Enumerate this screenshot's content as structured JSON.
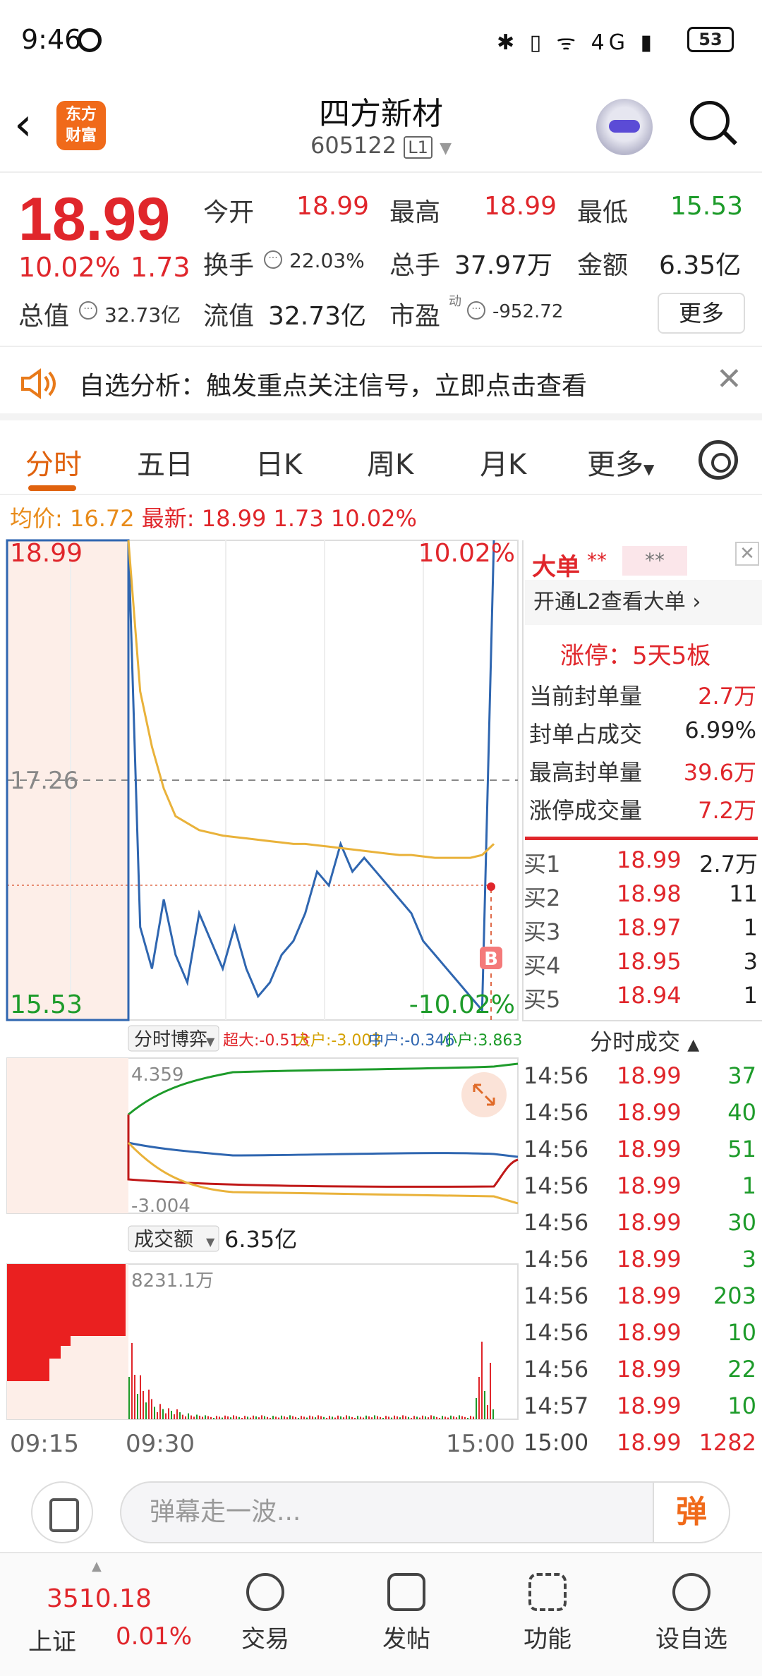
{
  "status_bar": {
    "time": "9:46",
    "signal": "4G",
    "battery": "53"
  },
  "header": {
    "logo_line1": "东方",
    "logo_line2": "财富",
    "stock_name": "四方新材",
    "stock_code": "605122",
    "level_badge": "L1"
  },
  "quote": {
    "price": "18.99",
    "change_pct": "10.02%",
    "change": "1.73",
    "open_label": "今开",
    "open": "18.99",
    "high_label": "最高",
    "high": "18.99",
    "low_label": "最低",
    "low": "15.53",
    "turnover_label": "换手",
    "turnover": "22.03%",
    "volume_label": "总手",
    "volume": "37.97万",
    "amount_label": "金额",
    "amount": "6.35亿",
    "mktcap_label": "总值",
    "mktcap": "32.73亿",
    "float_label": "流值",
    "float_cap": "32.73亿",
    "pe_label": "市盈",
    "pe_sup": "动",
    "pe": "-952.72",
    "more_label": "更多"
  },
  "alert": {
    "text": "自选分析：触发重点关注信号，立即点击查看"
  },
  "tabs": [
    "分时",
    "五日",
    "日K",
    "周K",
    "月K",
    "更多"
  ],
  "infoline": {
    "avg_label": "均价:",
    "avg": "16.72",
    "latest_label": "最新:",
    "latest": "18.99",
    "chg": "1.73",
    "pct": "10.02%"
  },
  "chart_labels": {
    "top_price": "18.99",
    "top_pct": "10.02%",
    "mid_price": "17.26",
    "bottom_price": "15.53",
    "bottom_pct": "-10.02%",
    "b_marker": "B",
    "fund_title": "分时博弈",
    "fund_super": "超大:-0.513",
    "fund_big": "大户:-3.003",
    "fund_mid": "中户:-0.346",
    "fund_small": "小户:3.863",
    "fund_max": "4.359",
    "fund_min": "-3.004",
    "amount_title": "成交额",
    "amount_total": "6.35亿",
    "amount_max": "8231.1万",
    "t_start": "09:15",
    "t_open": "09:30",
    "t_end": "15:00"
  },
  "chart_data": {
    "type": "line",
    "title": "",
    "y_range": [
      15.53,
      18.99
    ],
    "x_range": [
      "09:30",
      "15:00"
    ],
    "series": [
      {
        "name": "",
        "color": "#2f66b0",
        "values": [
          18.99,
          16.2,
          15.9,
          16.4,
          16.0,
          15.8,
          16.3,
          16.1,
          15.9,
          16.2,
          15.9,
          15.7,
          15.8,
          16.0,
          16.1,
          16.3,
          16.6,
          16.5,
          16.8,
          16.6,
          16.7,
          16.6,
          16.5,
          16.4,
          16.3,
          16.1,
          16.0,
          15.9,
          15.8,
          15.7,
          15.6,
          18.99
        ]
      },
      {
        "name": "均价",
        "color": "#e9b23a",
        "values": [
          18.99,
          17.9,
          17.5,
          17.2,
          17.0,
          16.95,
          16.9,
          16.88,
          16.86,
          16.85,
          16.84,
          16.83,
          16.82,
          16.81,
          16.8,
          16.8,
          16.79,
          16.78,
          16.77,
          16.76,
          16.75,
          16.74,
          16.73,
          16.72,
          16.72,
          16.71,
          16.7,
          16.7,
          16.7,
          16.7,
          16.72,
          16.8
        ]
      }
    ]
  },
  "big_order": {
    "title": "大单",
    "mask1": "**",
    "mask2": "**",
    "l2_link": "开通L2查看大单 ›",
    "limit_up": "涨停：5天5板",
    "rows": [
      {
        "label": "当前封单量",
        "value": "2.7万"
      },
      {
        "label": "封单占成交",
        "value": "6.99%"
      },
      {
        "label": "最高封单量",
        "value": "39.6万"
      },
      {
        "label": "涨停成交量",
        "value": "7.2万"
      }
    ]
  },
  "order_book": [
    {
      "label": "买1",
      "price": "18.99",
      "vol": "2.7万"
    },
    {
      "label": "买2",
      "price": "18.98",
      "vol": "11"
    },
    {
      "label": "买3",
      "price": "18.97",
      "vol": "1"
    },
    {
      "label": "买4",
      "price": "18.95",
      "vol": "3"
    },
    {
      "label": "买5",
      "price": "18.94",
      "vol": "1"
    }
  ],
  "ticks_title": "分时成交",
  "ticks": [
    {
      "time": "14:56",
      "price": "18.99",
      "vol": "37"
    },
    {
      "time": "14:56",
      "price": "18.99",
      "vol": "40"
    },
    {
      "time": "14:56",
      "price": "18.99",
      "vol": "51"
    },
    {
      "time": "14:56",
      "price": "18.99",
      "vol": "1"
    },
    {
      "time": "14:56",
      "price": "18.99",
      "vol": "30"
    },
    {
      "time": "14:56",
      "price": "18.99",
      "vol": "3"
    },
    {
      "time": "14:56",
      "price": "18.99",
      "vol": "203"
    },
    {
      "time": "14:56",
      "price": "18.99",
      "vol": "10"
    },
    {
      "time": "14:56",
      "price": "18.99",
      "vol": "22"
    },
    {
      "time": "14:57",
      "price": "18.99",
      "vol": "10"
    },
    {
      "time": "15:00",
      "price": "18.99",
      "vol": "1282"
    }
  ],
  "comment": {
    "placeholder": "弹幕走一波...",
    "send": "弹"
  },
  "bottom_nav": {
    "index_value": "3510.18",
    "index_name": "上证",
    "index_pct": "0.01%",
    "items": [
      "交易",
      "发帖",
      "功能",
      "设自选"
    ]
  },
  "colors": {
    "up": "#e0262b",
    "down": "#1d9b2a",
    "accent": "#e0620e"
  }
}
